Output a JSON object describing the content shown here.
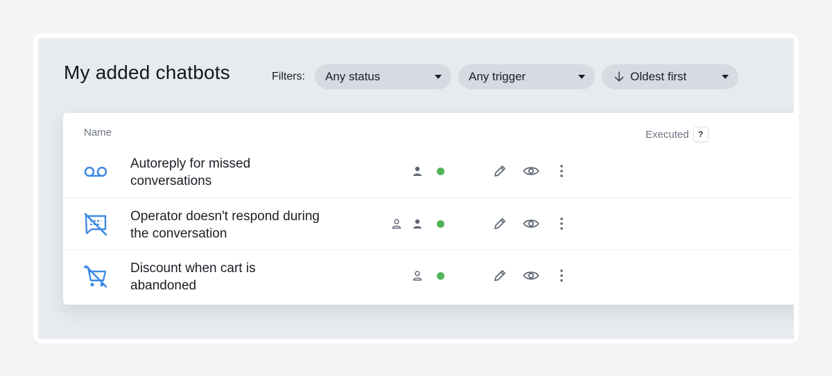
{
  "header": {
    "title": "My added chatbots",
    "filters_label": "Filters:"
  },
  "filters": {
    "status": "Any status",
    "trigger": "Any trigger",
    "sort": "Oldest first"
  },
  "table": {
    "columns": {
      "name": "Name",
      "executed": "Executed",
      "help": "?"
    },
    "rows": [
      {
        "name_line1": "Autoreply for missed",
        "name_line2": "conversations",
        "icon": "voicemail-icon",
        "indicators": [
          "person-filled-icon"
        ],
        "status": "active"
      },
      {
        "name_line1": "Operator doesn't respond during",
        "name_line2": "the conversation",
        "icon": "no-chat-icon",
        "indicators": [
          "person-outline-icon",
          "person-filled-icon"
        ],
        "status": "active"
      },
      {
        "name_line1": "Discount when cart is",
        "name_line2": "abandoned",
        "icon": "cart-off-icon",
        "indicators": [
          "person-outline-icon"
        ],
        "status": "active"
      }
    ]
  },
  "colors": {
    "accent": "#3d8ae6",
    "status_active": "#52b45a",
    "icon_gray": "#5d6472"
  }
}
